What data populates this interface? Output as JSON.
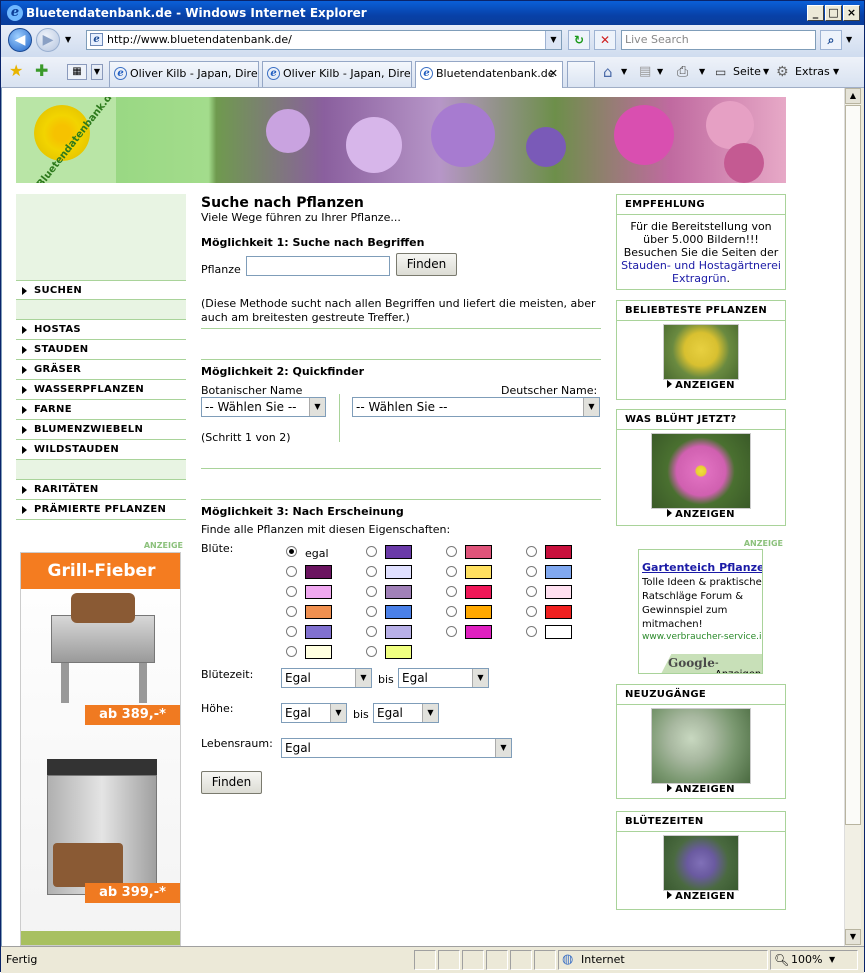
{
  "browser": {
    "window_title": "Bluetendatenbank.de - Windows Internet Explorer",
    "address": "http://www.bluetendatenbank.de/",
    "search_placeholder": "Live Search",
    "tabs": [
      {
        "label": "Oliver Kilb - Japan, Dire..."
      },
      {
        "label": "Oliver Kilb - Japan, Dire..."
      },
      {
        "label": "Bluetendatenbank.de",
        "active": true
      }
    ],
    "tools": {
      "page": "Seite",
      "extras": "Extras"
    },
    "status": {
      "left": "Fertig",
      "zone": "Internet",
      "zoom": "100%"
    }
  },
  "banner": {
    "logo_text": "Bluetendatenbank.de"
  },
  "leftnav": {
    "search": "SUCHEN",
    "items": [
      "HOSTAS",
      "STAUDEN",
      "GRÄSER",
      "WASSERPFLANZEN",
      "FARNE",
      "BLUMENZWIEBELN",
      "WILDSTAUDEN"
    ],
    "items2": [
      "RARITÄTEN",
      "PRÄMIERTE PFLANZEN"
    ],
    "ad_label": "ANZEIGE",
    "ad": {
      "headline": "Grill-Fieber",
      "price1": "ab 389,-*",
      "price2": "ab 399,-*"
    }
  },
  "main": {
    "title": "Suche nach Pflanzen",
    "subtitle": "Viele Wege führen zu Ihrer Pflanze...",
    "m1": {
      "heading": "Möglichkeit 1: Suche nach Begriffen",
      "field_label": "Pflanze",
      "button": "Finden",
      "note": "(Diese Methode sucht nach allen Begriffen und liefert die meisten, aber auch am breitesten gestreute Treffer.)"
    },
    "m2": {
      "heading": "Möglichkeit 2: Quickfinder",
      "bot_label": "Botanischer Name",
      "de_label": "Deutscher Name:",
      "bot_select": "-- Wählen Sie --",
      "de_select": "-- Wählen Sie --",
      "step": "(Schritt 1 von 2)"
    },
    "m3": {
      "heading": "Möglichkeit 3: Nach Erscheinung",
      "intro": "Finde alle Pflanzen mit diesen Eigenschaften:",
      "bluete_label": "Blüte:",
      "egal": "egal",
      "colors": [
        "#6a3aa8",
        "#e0547a",
        "#c8103c",
        "#6b1460",
        "#e0e0ff",
        "#ffe060",
        "#80a8f0",
        "#f0a8f0",
        "#a080b8",
        "#f01858",
        "#ffe0f0",
        "#f09050",
        "#4a80e8",
        "#ffa800",
        "#f02020",
        "#8070d0",
        "#b8b0e8",
        "#e020c0",
        "#ffffff",
        "#ffffe0",
        "#f0ff80"
      ],
      "bluetezeit_label": "Blütezeit:",
      "bis": "bis",
      "hoehe_label": "Höhe:",
      "lebensraum_label": "Lebensraum:",
      "egal_select": "Egal",
      "button": "Finden"
    }
  },
  "right": {
    "empfehlung": {
      "title": "EMPFEHLUNG",
      "text1": "Für die Bereitstellung von über 5.000 Bildern!!! Besuchen Sie die Seiten der",
      "link": "Stauden- und Hostagärtnerei Extragrün",
      "dot": "."
    },
    "beliebteste": {
      "title": "BELIEBTESTE PFLANZEN",
      "link": "ANZEIGEN"
    },
    "bluehtjetzt": {
      "title": "WAS BLÜHT JETZT?",
      "link": "ANZEIGEN"
    },
    "ad_label": "ANZEIGE",
    "google_ad": {
      "title": "Gartenteich Pflanzen",
      "text": "Tolle Ideen & praktische Ratschläge Forum & Gewinnspiel zum mitmachen!",
      "url": "www.verbraucher-service.i",
      "footer_brand": "Google",
      "footer_text": "-Anzeigen"
    },
    "neuzugaenge": {
      "title": "NEUZUGÄNGE",
      "link": "ANZEIGEN"
    },
    "bluetezeiten": {
      "title": "BLÜTEZEITEN",
      "link": "ANZEIGEN"
    }
  },
  "icons": [
    "ie-logo-icon",
    "back-icon",
    "forward-icon",
    "refresh-icon",
    "stop-icon",
    "search-icon",
    "favorites-star-icon",
    "add-favorite-icon",
    "tab-list-icon",
    "home-icon",
    "feeds-icon",
    "print-icon",
    "page-icon",
    "tools-gear-icon",
    "globe-icon",
    "zoom-icon"
  ]
}
